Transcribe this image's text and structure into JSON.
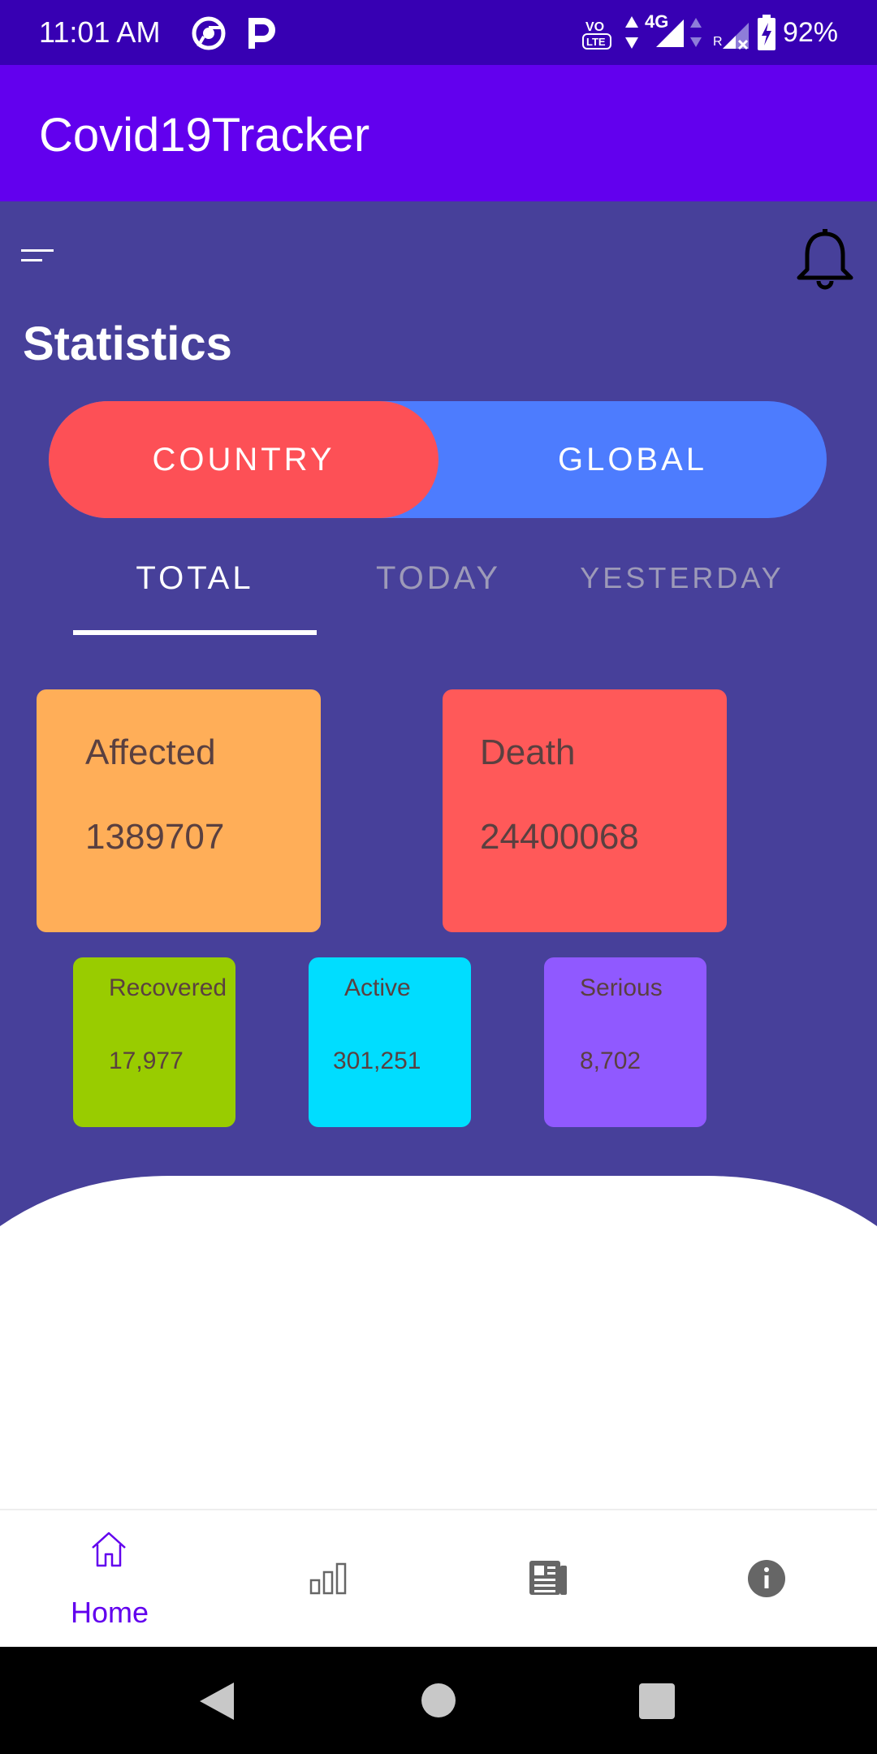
{
  "status_bar": {
    "time": "11:01 AM",
    "network": "4G",
    "battery": "92%"
  },
  "app_bar": {
    "title": "Covid19Tracker"
  },
  "main": {
    "title": "Statistics",
    "toggle": {
      "country_label": "COUNTRY",
      "global_label": "GLOBAL",
      "selected": "COUNTRY"
    },
    "tabs": [
      {
        "label": "TOTAL",
        "active": true
      },
      {
        "label": "TODAY",
        "active": false
      },
      {
        "label": "YESTERDAY",
        "active": false
      }
    ],
    "cards": {
      "affected": {
        "label": "Affected",
        "value": "1389707",
        "color": "#ffae58"
      },
      "death": {
        "label": "Death",
        "value": "24400068",
        "color": "#ff5959"
      },
      "recovered": {
        "label": "Recovered",
        "value": "17,977",
        "color": "#99cc00"
      },
      "active": {
        "label": "Active",
        "value": "301,251",
        "color": "#00ddff"
      },
      "serious": {
        "label": "Serious",
        "value": "8,702",
        "color": "#9059ff"
      }
    }
  },
  "bottom_nav": {
    "items": [
      {
        "icon": "home-icon",
        "label": "Home",
        "selected": true
      },
      {
        "icon": "bar-chart-icon",
        "label": "",
        "selected": false
      },
      {
        "icon": "newspaper-icon",
        "label": "",
        "selected": false
      },
      {
        "icon": "info-icon",
        "label": "",
        "selected": false
      }
    ]
  },
  "colors": {
    "primary": "#6200ee",
    "primary_dark": "#3700b3",
    "background": "#47409a",
    "toggle_selected": "#fd5056",
    "toggle_bg": "#4d7cfe"
  }
}
